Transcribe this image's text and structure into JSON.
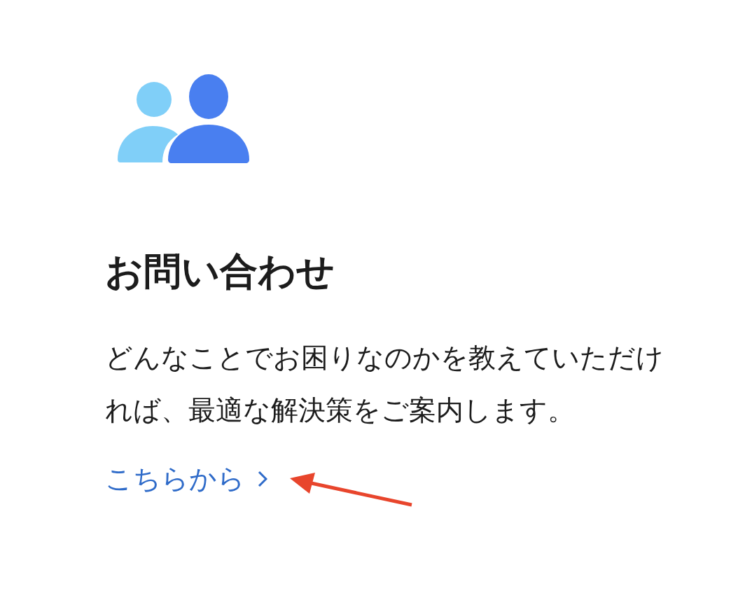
{
  "card": {
    "title": "お問い合わせ",
    "description": "どんなことでお困りなのかを教えていただければ、最適な解決策をご案内します。",
    "link": {
      "label": "こちらから"
    }
  }
}
